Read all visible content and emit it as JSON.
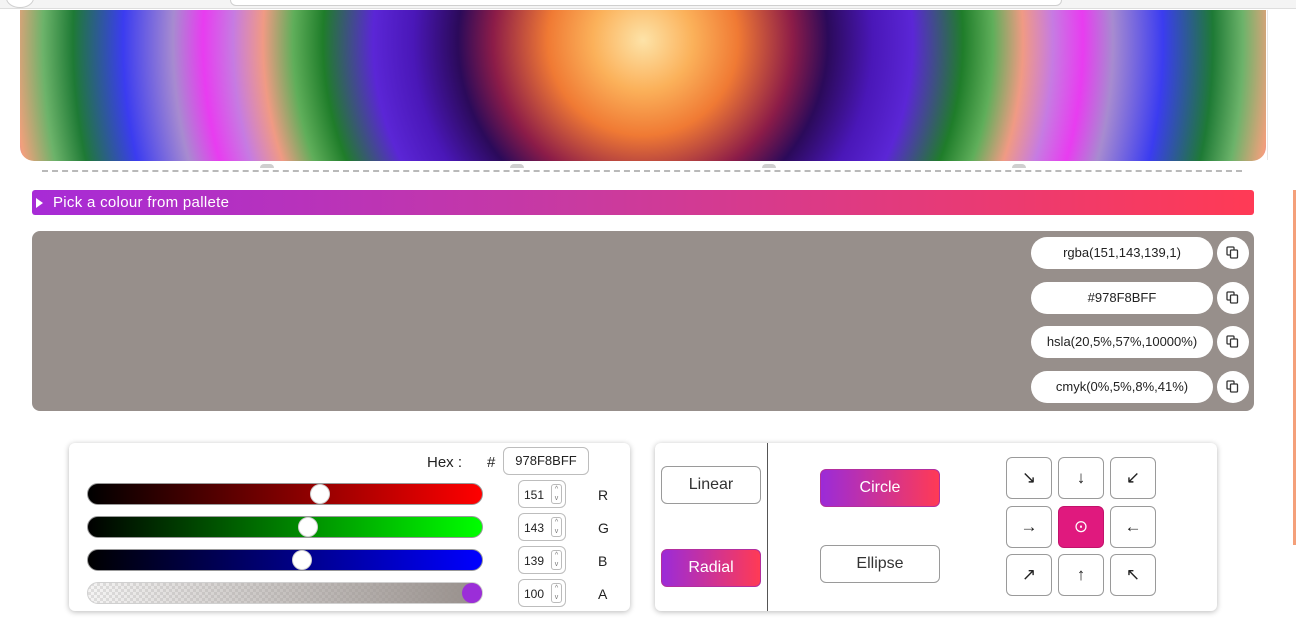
{
  "preview": {
    "gradient_colors": [
      "#fde3a8",
      "#fbb15a",
      "#f07a34",
      "#8c1c48",
      "#2b0a5a",
      "#4a17b8",
      "#5b26d6",
      "#1f7d2a",
      "#5fae5a",
      "#f09a84",
      "#e83cf0",
      "#3b3cf0"
    ]
  },
  "palette_toggle": {
    "label": "Pick a colour from pallete"
  },
  "swatch": {
    "color": "#978f8b",
    "formats": [
      {
        "id": "rgba",
        "value": "rgba(151,143,139,1)"
      },
      {
        "id": "hex",
        "value": "#978F8BFF"
      },
      {
        "id": "hsla",
        "value": "hsla(20,5%,57%,10000%)"
      },
      {
        "id": "cmyk",
        "value": "cmyk(0%,5%,8%,41%)"
      }
    ],
    "copy_icon": "copy-icon"
  },
  "picker": {
    "hex_label": "Hex :",
    "hash": "#",
    "hex_value": "978F8BFF",
    "channels": [
      {
        "name": "R",
        "value": "151",
        "max": 255
      },
      {
        "name": "G",
        "value": "143",
        "max": 255
      },
      {
        "name": "B",
        "value": "139",
        "max": 255
      },
      {
        "name": "A",
        "value": "100",
        "max": 100
      }
    ]
  },
  "gradient": {
    "types": {
      "linear": "Linear",
      "radial": "Radial",
      "selected": "Radial"
    },
    "shapes": {
      "circle": "Circle",
      "ellipse": "Ellipse",
      "selected": "Circle"
    },
    "directions": [
      {
        "id": "top-left",
        "glyph": "↘"
      },
      {
        "id": "top",
        "glyph": "↓"
      },
      {
        "id": "top-right",
        "glyph": "↙"
      },
      {
        "id": "left",
        "glyph": "→"
      },
      {
        "id": "center",
        "glyph": "⊙"
      },
      {
        "id": "right",
        "glyph": "←"
      },
      {
        "id": "bottom-left",
        "glyph": "↗"
      },
      {
        "id": "bottom",
        "glyph": "↑"
      },
      {
        "id": "bottom-right",
        "glyph": "↖"
      }
    ],
    "selected_direction": "center"
  }
}
